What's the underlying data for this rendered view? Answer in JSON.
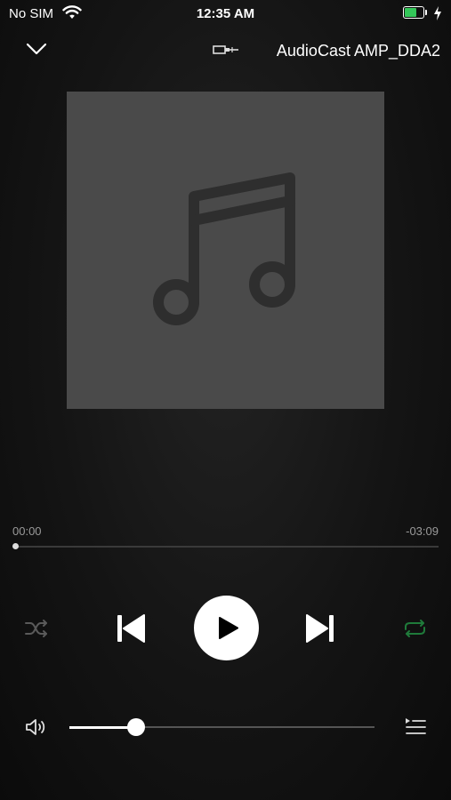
{
  "status_bar": {
    "carrier": "No SIM",
    "time": "12:35 AM",
    "battery_level": 0.7,
    "charging": true,
    "wifi_icon": "wifi-icon"
  },
  "header": {
    "close_icon": "chevron-down-icon",
    "output_icon": "audio-cable-icon",
    "device_name": "AudioCast AMP_DDA2"
  },
  "artwork": {
    "icon": "music-note-icon",
    "background": "#4a4a4a",
    "icon_color": "#2e2e2e"
  },
  "progress": {
    "elapsed": "00:00",
    "remaining": "-03:09",
    "position": 0.0
  },
  "controls": {
    "shuffle_icon": "shuffle-icon",
    "shuffle_active": false,
    "previous_icon": "skip-previous-icon",
    "play_icon": "play-icon",
    "next_icon": "skip-next-icon",
    "repeat_icon": "repeat-icon",
    "repeat_active": true,
    "repeat_color": "#1f7a3a"
  },
  "volume": {
    "speaker_icon": "speaker-icon",
    "level": 0.22,
    "queue_icon": "queue-list-icon"
  }
}
